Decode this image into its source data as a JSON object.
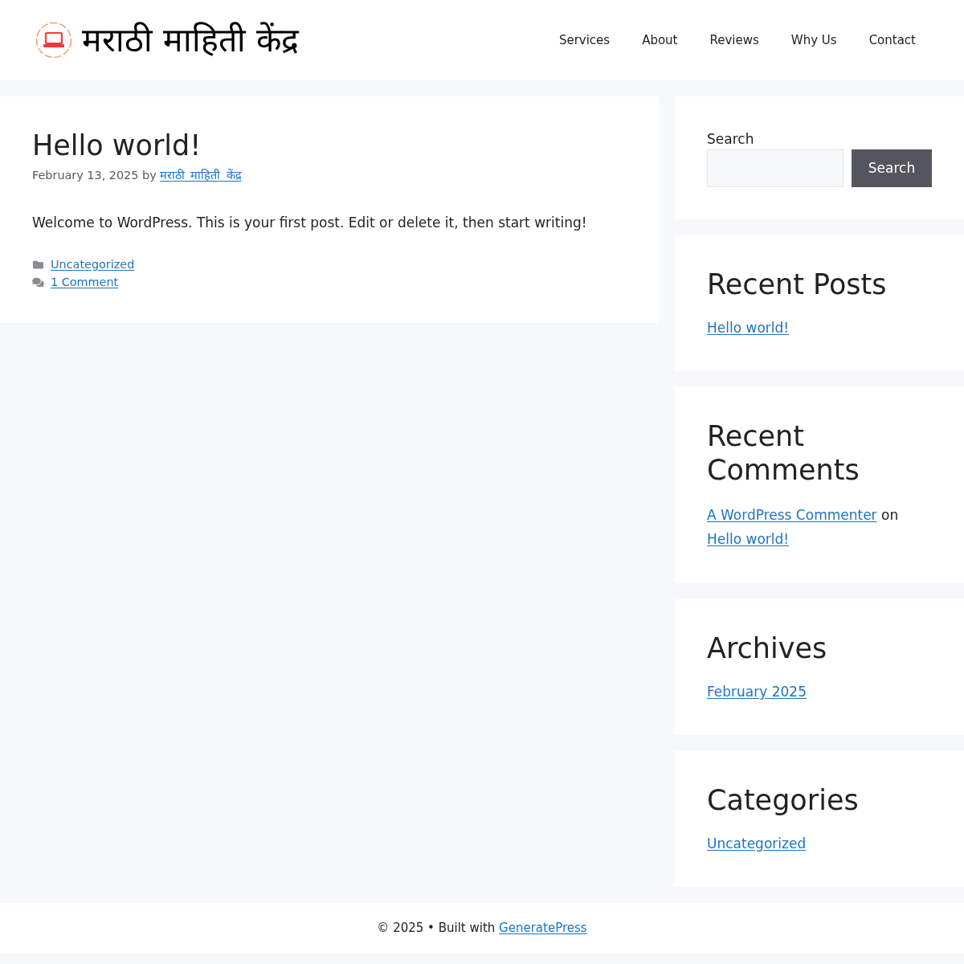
{
  "header": {
    "site_title": "मराठी माहिती केंद्र",
    "nav": [
      "Services",
      "About",
      "Reviews",
      "Why Us",
      "Contact"
    ]
  },
  "post": {
    "title": "Hello world!",
    "meta": "February 13, 2025 by",
    "author": "मराठी_माहिती_केंद्र",
    "content": "Welcome to WordPress. This is your first post. Edit or delete it, then start writing!",
    "footer": [
      {
        "kind": "category",
        "label": "Uncategorized"
      },
      {
        "kind": "comments",
        "label": "1 Comment"
      }
    ]
  },
  "sidebar": [
    {
      "kind": "search",
      "label": "Search",
      "button": "Search"
    },
    {
      "kind": "links",
      "title": "Recent Posts",
      "links": [
        "Hello world!"
      ]
    },
    {
      "kind": "comments",
      "title": "Recent Comments",
      "comments": [
        {
          "author": "A WordPress Commenter",
          "joiner": "on",
          "post": "Hello world!"
        }
      ]
    },
    {
      "kind": "links",
      "title": "Archives",
      "links": [
        "February 2025"
      ]
    },
    {
      "kind": "links",
      "title": "Categories",
      "links": [
        "Uncategorized"
      ]
    }
  ],
  "footer": {
    "text": "© 2025 • Built with",
    "link": "GeneratePress"
  }
}
